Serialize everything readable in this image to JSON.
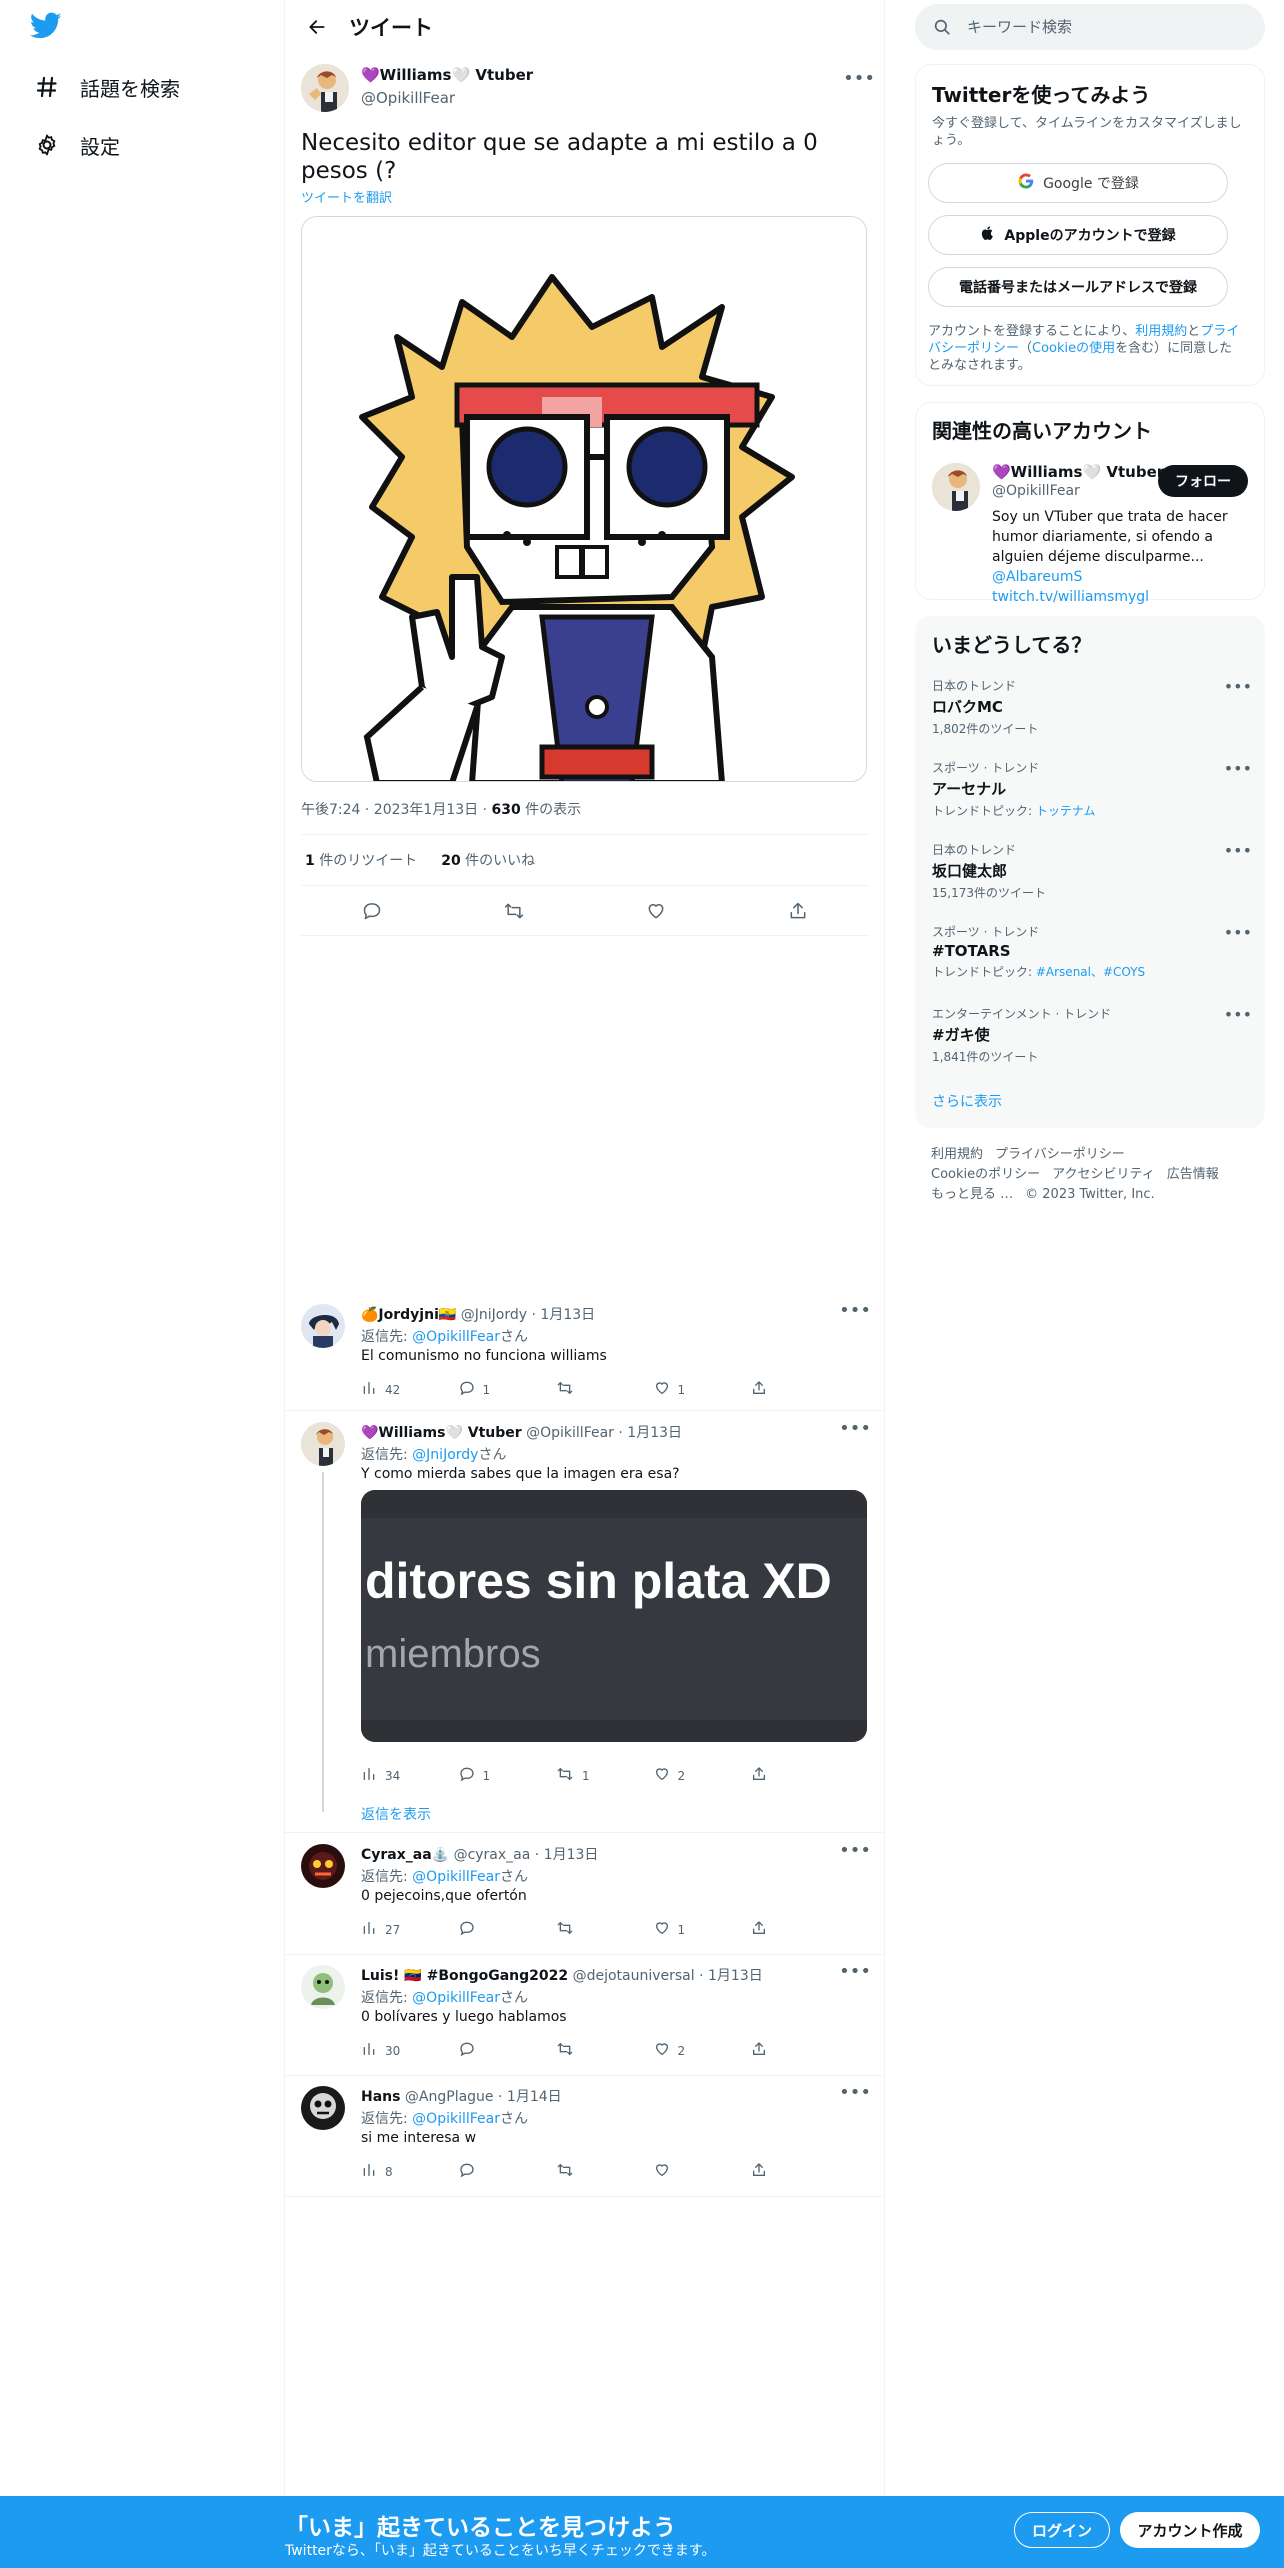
{
  "nav": {
    "items": [
      {
        "label": "話題を検索",
        "icon": "hashtag-icon"
      },
      {
        "label": "設定",
        "icon": "gear-icon"
      }
    ]
  },
  "header": {
    "title": "ツイート"
  },
  "tweet": {
    "name": "💜Williams🤍 Vtuber",
    "handle": "@OpikillFear",
    "text": "Necesito editor que se adapte a mi estilo a 0 pesos (?",
    "translate": "ツイートを翻訳",
    "time": "午後7:24 · 2023年1月13日 · ",
    "views_count": "630",
    "views_label": " 件の表示",
    "retweets_count": "1",
    "retweets_label": " 件のリツイート",
    "likes_count": "20",
    "likes_label": " 件のいいね"
  },
  "replies": [
    {
      "name": "🍊Jordyjni🇪🇨",
      "handle": "@JniJordy",
      "date": "1月13日",
      "to_prefix": "返信先: ",
      "to_handle": "@OpikillFear",
      "to_suffix": "さん",
      "text": "El comunismo no funciona williams",
      "views": "42",
      "replies": "1",
      "retweets": "",
      "likes": "1"
    },
    {
      "name": "💜Williams🤍 Vtuber",
      "handle": "@OpikillFear",
      "date": "1月13日",
      "to_prefix": "返信先: ",
      "to_handle": "@JniJordy",
      "to_suffix": "さん",
      "text": "Y como mierda sabes que la imagen era esa?",
      "embed_big": "ditores sin plata XD",
      "embed_small": "miembros",
      "views": "34",
      "replies": "1",
      "retweets": "1",
      "likes": "2",
      "show_replies": "返信を表示"
    },
    {
      "name": "Cyrax_aa⛲",
      "handle": "@cyrax_aa",
      "date": "1月13日",
      "to_prefix": "返信先: ",
      "to_handle": "@OpikillFear",
      "to_suffix": "さん",
      "text": "0 pejecoins,que ofertón",
      "views": "27",
      "replies": "",
      "retweets": "",
      "likes": "1"
    },
    {
      "name": "Luis! 🇻🇪 #BongoGang2022",
      "handle": "@dejotauniversal",
      "date": "1月13日",
      "to_prefix": "返信先: ",
      "to_handle": "@OpikillFear",
      "to_suffix": "さん",
      "text": "0 bolívares y luego hablamos",
      "views": "30",
      "replies": "",
      "retweets": "",
      "likes": "2"
    },
    {
      "name": "Hans",
      "handle": "@AngPlague",
      "date": "1月14日",
      "to_prefix": "返信先: ",
      "to_handle": "@OpikillFear",
      "to_suffix": "さん",
      "text": "si me interesa w",
      "views": "8",
      "replies": "",
      "retweets": "",
      "likes": ""
    }
  ],
  "search": {
    "placeholder": "キーワード検索"
  },
  "signup": {
    "title": "Twitterを使ってみよう",
    "subtitle": "今すぐ登録して、タイムラインをカスタマイズしましょう。",
    "google": "Google で登録",
    "apple": "Appleのアカウントで登録",
    "phone": "電話番号またはメールアドレスで登録",
    "legal_1": "アカウントを登録することにより、",
    "legal_terms": "利用規約",
    "legal_2": "と",
    "legal_privacy": "プライバシーポリシー",
    "legal_3": "（",
    "legal_cookie": "Cookieの使用",
    "legal_4": "を含む）に同意したとみなされます。"
  },
  "related": {
    "title": "関連性の高いアカウント",
    "name": "💜Williams🤍 Vtuber",
    "handle": "@OpikillFear",
    "follow": "フォロー",
    "bio": "Soy un VTuber que trata de hacer humor diariamente, si ofendo a alguien déjeme disculparme... ",
    "bio_mention": "@AlbareumS",
    "bio_link": "twitch.tv/williamsmygl"
  },
  "trends": {
    "title": "いまどうしてる？",
    "items": [
      {
        "category": "日本のトレンド",
        "name": "ロバクMC",
        "sub": "1,802件のツイート"
      },
      {
        "category": "スポーツ · トレンド",
        "name": "アーセナル",
        "sub": "トレンドトピック: ",
        "sub_link": "トッテナム"
      },
      {
        "category": "日本のトレンド",
        "name": "坂口健太郎",
        "sub": "15,173件のツイート"
      },
      {
        "category": "スポーツ · トレンド",
        "name": "#TOTARS",
        "sub": "トレンドトピック: ",
        "sub_link": "#Arsenal、#COYS"
      },
      {
        "category": "エンターテインメント · トレンド",
        "name": "#ガキ使",
        "sub": "1,841件のツイート"
      }
    ],
    "show_more": "さらに表示"
  },
  "footer": {
    "links": [
      "利用規約",
      "プライバシーポリシー",
      "Cookieのポリシー",
      "アクセシビリティ",
      "広告情報",
      "もっと見る …",
      "© 2023 Twitter, Inc."
    ]
  },
  "bottombar": {
    "title": "「いま」起きていることを見つけよう",
    "subtitle": "Twitterなら、「いま」起きていることをいち早くチェックできます。",
    "login": "ログイン",
    "signup": "アカウント作成"
  },
  "colors": {
    "accent": "#1d9bf0",
    "text": "#0f1419",
    "secondary": "#536471"
  }
}
